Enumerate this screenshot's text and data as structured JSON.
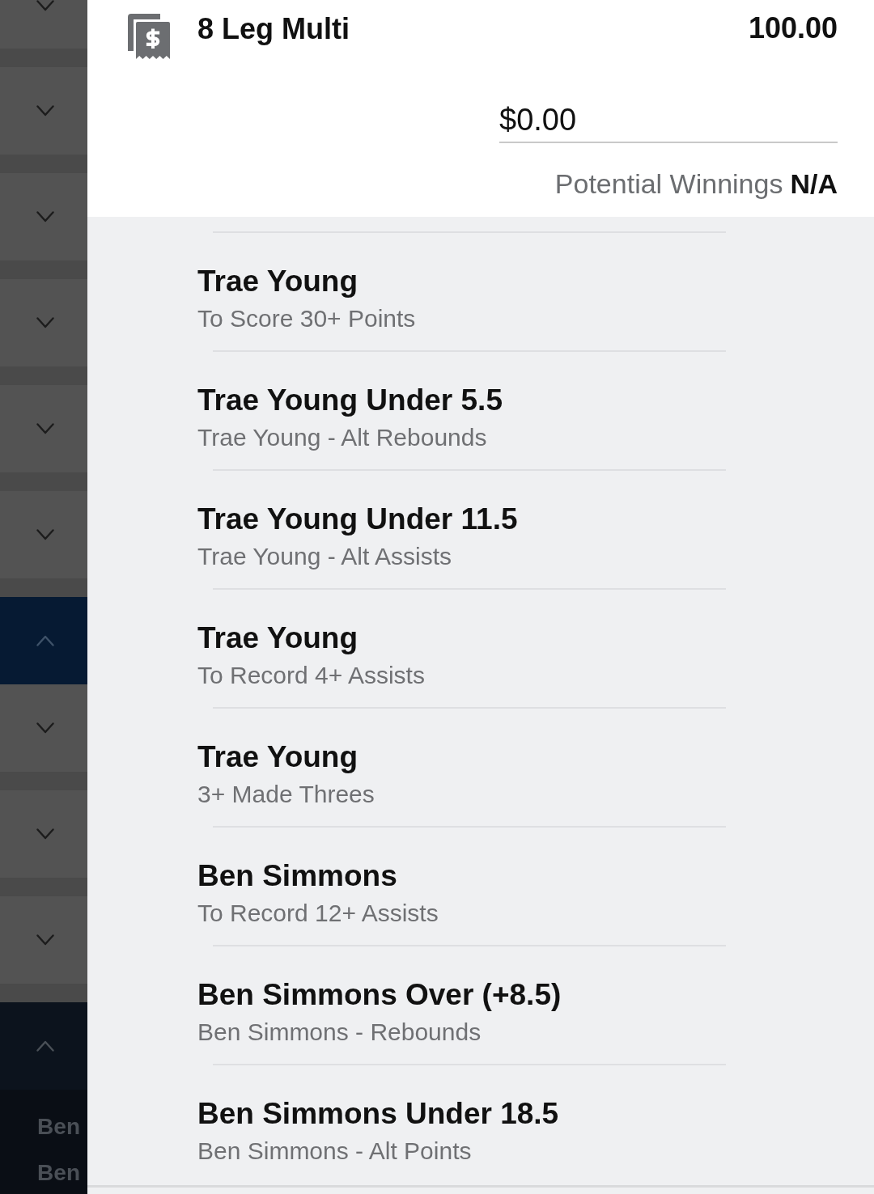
{
  "sidebar": {
    "items": [
      {
        "expanded": false
      },
      {
        "expanded": false
      },
      {
        "expanded": false
      },
      {
        "expanded": false
      },
      {
        "expanded": false
      },
      {
        "expanded": false
      },
      {
        "expanded": true
      },
      {
        "expanded": false
      },
      {
        "expanded": false
      },
      {
        "expanded": false
      },
      {
        "expanded": true,
        "children": [
          "Ben",
          "Ben"
        ]
      }
    ]
  },
  "bet": {
    "title": "8 Leg Multi",
    "amount": "100.00",
    "stake": {
      "value": "$0.00"
    },
    "potential_winnings": {
      "label": "Potential Winnings",
      "value": "N/A"
    }
  },
  "legs": [
    {
      "title": "Trae Young",
      "market": "To Score 30+ Points"
    },
    {
      "title": "Trae Young Under 5.5",
      "market": "Trae Young - Alt Rebounds"
    },
    {
      "title": "Trae Young Under 11.5",
      "market": "Trae Young - Alt Assists"
    },
    {
      "title": "Trae Young",
      "market": "To Record 4+ Assists"
    },
    {
      "title": "Trae Young",
      "market": "3+ Made Threes"
    },
    {
      "title": "Ben Simmons",
      "market": "To Record 12+ Assists"
    },
    {
      "title": "Ben Simmons Over (+8.5)",
      "market": "Ben Simmons - Rebounds"
    },
    {
      "title": "Ben Simmons Under 18.5",
      "market": "Ben Simmons - Alt Points"
    }
  ]
}
